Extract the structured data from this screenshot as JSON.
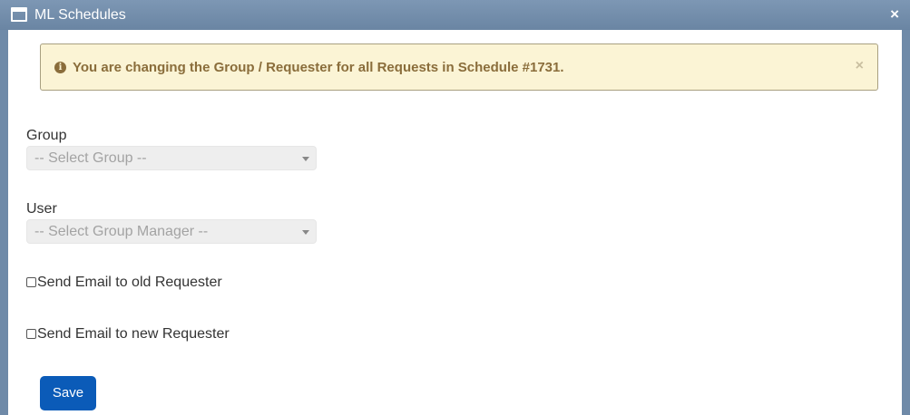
{
  "window": {
    "title": "ML Schedules",
    "close_glyph": "×",
    "icon": "window-icon"
  },
  "alert": {
    "icon": "info-circle-icon",
    "icon_glyph": "i",
    "message": "You are changing the Group / Requester for all Requests in Schedule #1731.",
    "close_glyph": "×",
    "colors": {
      "background": "#fbf4d5",
      "text": "#8a6d3b"
    }
  },
  "form": {
    "group_label": "Group",
    "group_select_value": "-- Select Group --",
    "user_label": "User",
    "user_select_value": "-- Select Group Manager --",
    "email_old_label": "Send Email to old Requester",
    "email_old_checked": false,
    "email_new_label": "Send Email to new Requester",
    "email_new_checked": false,
    "save_label": "Save"
  },
  "colors": {
    "titlebar": "#6f8aa8",
    "primary_button": "#0b5bb8"
  }
}
